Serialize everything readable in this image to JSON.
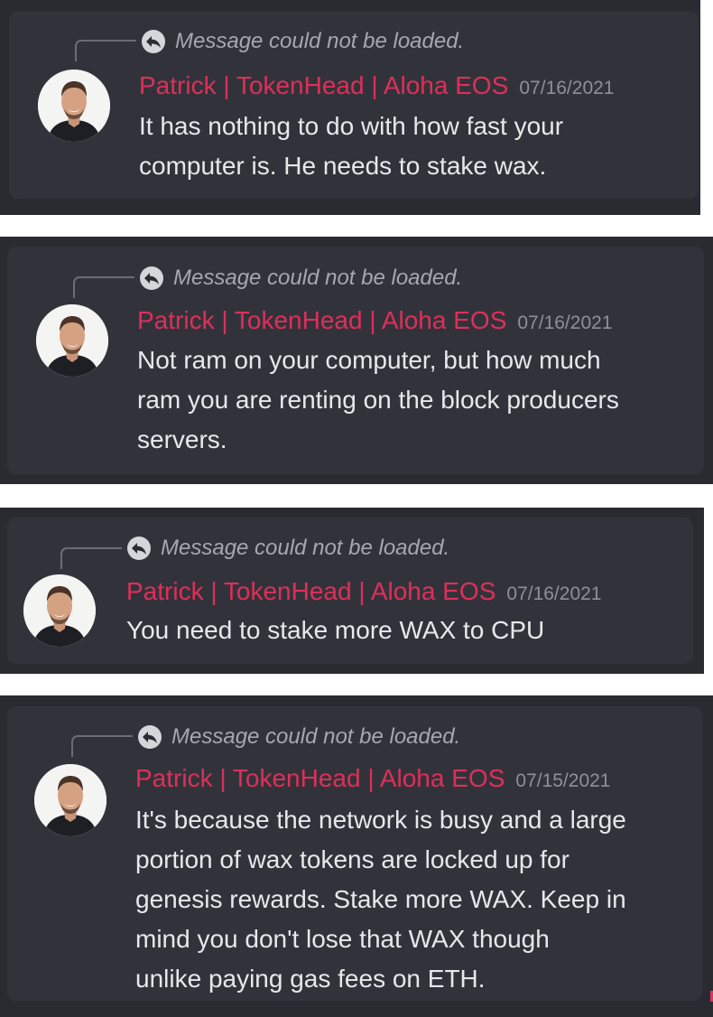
{
  "reply_notice": "Message could not be loaded.",
  "messages": [
    {
      "author": "Patrick | TokenHead | Aloha EOS",
      "timestamp": "07/16/2021",
      "lines": [
        "It has nothing to do with how fast your",
        "computer is. He needs to stake wax."
      ]
    },
    {
      "author": "Patrick | TokenHead | Aloha EOS",
      "timestamp": "07/16/2021",
      "lines": [
        "Not ram on your computer, but how much",
        "ram you are renting on the block producers",
        "servers."
      ]
    },
    {
      "author": "Patrick | TokenHead | Aloha EOS",
      "timestamp": "07/16/2021",
      "lines": [
        "You need to stake more WAX to CPU"
      ]
    },
    {
      "author": "Patrick | TokenHead | Aloha EOS",
      "timestamp": "07/15/2021",
      "lines": [
        "It's because the network is busy and a large",
        "portion of wax tokens are locked up for",
        "genesis rewards. Stake more WAX. Keep in",
        "mind you don't lose that WAX though",
        "unlike paying gas fees on ETH."
      ]
    }
  ],
  "colors": {
    "author": "#de2f5a",
    "timestamp": "#8d9096",
    "body": "#e7e8ea",
    "card": "#32333a",
    "strip": "#2a2b30"
  },
  "icons": {
    "reply": "reply-arrow-icon",
    "avatar": "user-avatar"
  }
}
